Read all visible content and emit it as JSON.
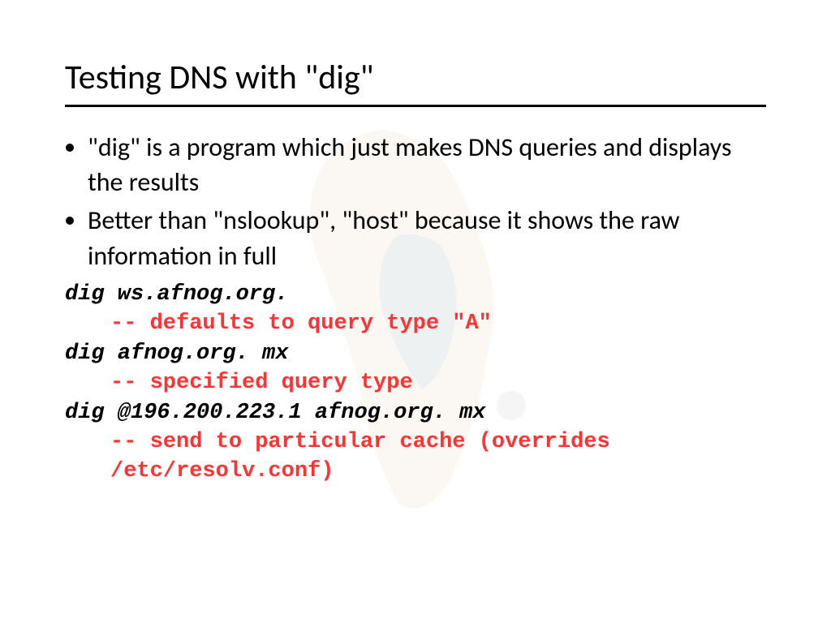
{
  "slide": {
    "title": "Testing DNS with \"dig\"",
    "bullets": [
      "\"dig\" is a program which just makes DNS queries and displays the results",
      "Better than \"nslookup\", \"host\" because it shows the raw information in full"
    ],
    "examples": [
      {
        "cmd": "dig ws.afnog.org.",
        "comment": "-- defaults to query type \"A\""
      },
      {
        "cmd": "dig afnog.org. mx",
        "comment": "-- specified query type"
      },
      {
        "cmd": "dig @196.200.223.1 afnog.org. mx",
        "comment": "-- send to particular cache (overrides /etc/resolv.conf)"
      }
    ]
  }
}
